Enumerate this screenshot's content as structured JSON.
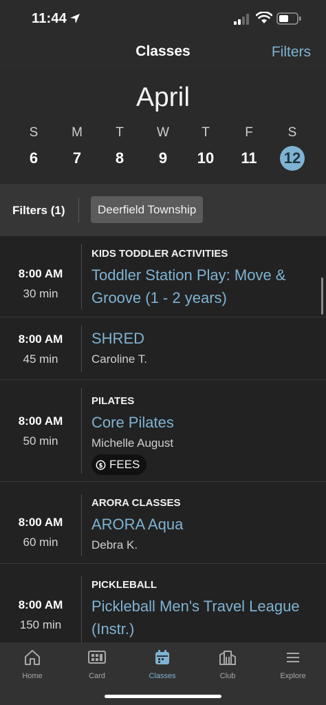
{
  "status_bar": {
    "time": "11:44"
  },
  "nav": {
    "title": "Classes",
    "filters_link": "Filters"
  },
  "calendar": {
    "month": "April",
    "days": [
      {
        "letter": "S",
        "num": "6",
        "selected": false
      },
      {
        "letter": "M",
        "num": "7",
        "selected": false
      },
      {
        "letter": "T",
        "num": "8",
        "selected": false
      },
      {
        "letter": "W",
        "num": "9",
        "selected": false
      },
      {
        "letter": "T",
        "num": "10",
        "selected": false
      },
      {
        "letter": "F",
        "num": "11",
        "selected": false
      },
      {
        "letter": "S",
        "num": "12",
        "selected": true
      }
    ]
  },
  "filter_bar": {
    "count_label": "Filters (1)",
    "chip": "Deerfield Township"
  },
  "classes": [
    {
      "time": "8:00 AM",
      "duration": "30 min",
      "category": "KIDS TODDLER ACTIVITIES",
      "title": "Toddler Station Play: Move & Groove  (1 - 2 years)",
      "instructor": ""
    },
    {
      "time": "8:00 AM",
      "duration": "45 min",
      "category": "",
      "title": "SHRED",
      "instructor": "Caroline T."
    },
    {
      "time": "8:00 AM",
      "duration": "50 min",
      "category": "PILATES",
      "title": "Core Pilates",
      "instructor": "Michelle August",
      "badge": "FEES"
    },
    {
      "time": "8:00 AM",
      "duration": "60 min",
      "category": "ARORA CLASSES",
      "title": "ARORA Aqua",
      "instructor": "Debra K."
    },
    {
      "time": "8:00 AM",
      "duration": "150 min",
      "category": "PICKLEBALL",
      "title": "Pickleball Men's Travel League (Instr.)",
      "instructor": ""
    }
  ],
  "tabs": [
    {
      "label": "Home",
      "icon": "home-icon",
      "active": false
    },
    {
      "label": "Card",
      "icon": "card-icon",
      "active": false
    },
    {
      "label": "Classes",
      "icon": "calendar-icon",
      "active": true
    },
    {
      "label": "Club",
      "icon": "club-building-icon",
      "active": false
    },
    {
      "label": "Explore",
      "icon": "menu-icon",
      "active": false
    }
  ],
  "colors": {
    "accent": "#7fb3d3",
    "background": "#222222"
  }
}
